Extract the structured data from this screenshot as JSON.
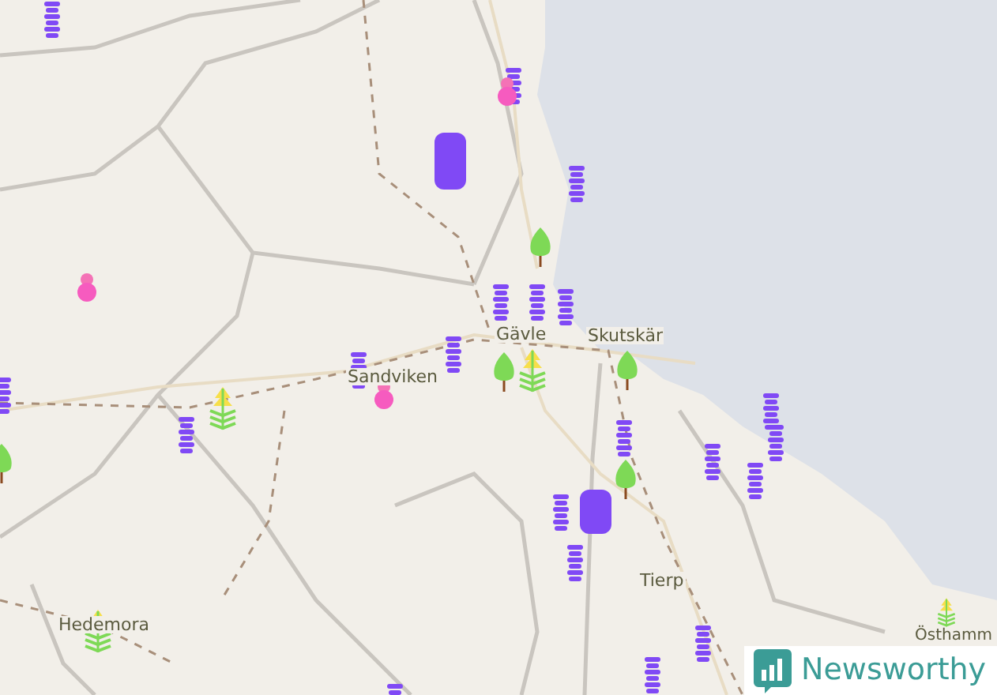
{
  "places": [
    {
      "name": "Gävle"
    },
    {
      "name": "Sandviken"
    },
    {
      "name": "Skutskär"
    },
    {
      "name": "Tierp"
    },
    {
      "name": "Hedemora"
    },
    {
      "name": "Östhamm"
    }
  ],
  "logo": {
    "text": "Newsworthy"
  }
}
